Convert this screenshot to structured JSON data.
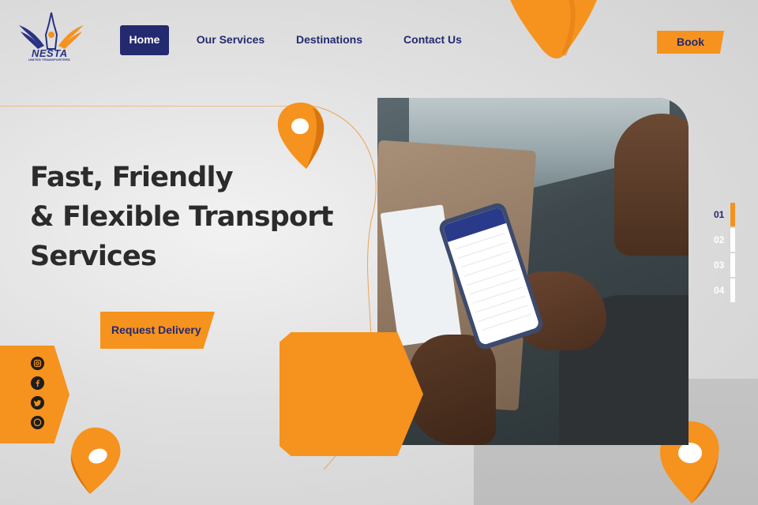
{
  "brand": {
    "name": "NESTA",
    "tagline": "UNITED TRANSPORTERS",
    "colors": {
      "navy": "#232a6f",
      "orange": "#f6921e"
    }
  },
  "nav": {
    "items": [
      {
        "label": "Home",
        "active": true
      },
      {
        "label": "Our Services",
        "active": false
      },
      {
        "label": "Destinations",
        "active": false
      },
      {
        "label": "Contact Us",
        "active": false
      }
    ],
    "book_label": "Book"
  },
  "hero": {
    "title_lines": [
      "Fast, Friendly",
      "& Flexible Transport",
      "Services"
    ],
    "cta_label": "Request Delivery"
  },
  "social": [
    {
      "icon": "instagram-icon"
    },
    {
      "icon": "facebook-icon"
    },
    {
      "icon": "twitter-icon"
    },
    {
      "icon": "whatsapp-icon"
    }
  ],
  "slides": {
    "items": [
      "01",
      "02",
      "03",
      "04"
    ],
    "active": "01"
  }
}
